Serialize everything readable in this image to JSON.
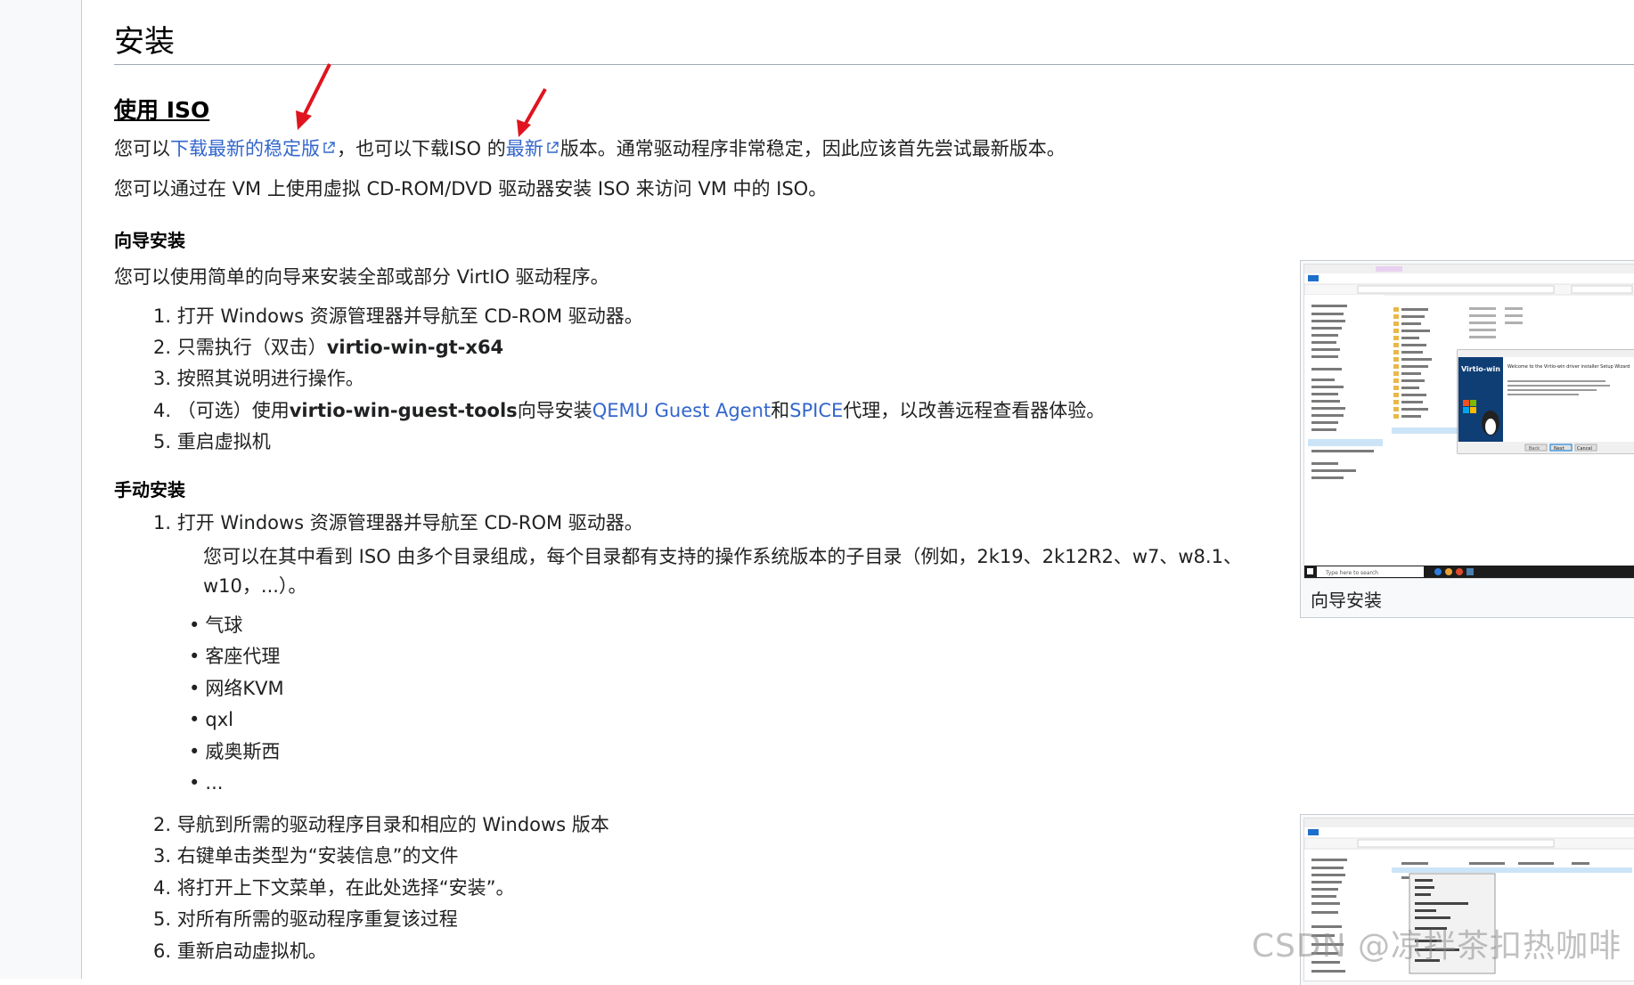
{
  "section_title": "安装",
  "iso": {
    "heading": "使用 ISO",
    "p1": {
      "pre": "您可以",
      "link1": "下载最新的稳定版",
      "mid": "，也可以下载ISO 的",
      "link2": "最新",
      "post": "版本。通常驱动程序非常稳定，因此应该首先尝试最新版本。"
    },
    "p2": "您可以通过在 VM 上使用虚拟 CD-ROM/DVD 驱动器安装 ISO 来访问 VM 中的 ISO。"
  },
  "wizard": {
    "heading": "向导安装",
    "intro": "您可以使用简单的向导来安装全部或部分 VirtIO 驱动程序。",
    "steps": {
      "s1": "1. 打开 Windows 资源管理器并导航至 CD-ROM 驱动器。",
      "s2_pre": "2. 只需执行（双击）",
      "s2_bold": "virtio-win-gt-x64",
      "s3": "3. 按照其说明进行操作。",
      "s4_pre": "4. （可选）使用",
      "s4_bold": "virtio-win-guest-tools",
      "s4_mid": "向导安装",
      "s4_link1": "QEMU Guest Agent",
      "s4_and": "和",
      "s4_link2": "SPICE",
      "s4_post": "代理，以改善远程查看器体验。",
      "s5": "5. 重启虚拟机"
    },
    "thumb_caption": "向导安装"
  },
  "manual": {
    "heading": "手动安装",
    "s1": "1. 打开 Windows 资源管理器并导航至 CD-ROM 驱动器。",
    "s1_desc_line1": "您可以在其中看到 ISO 由多个目录组成，每个目录都有支持的操作系统版本的子目录（例如，2k19、2k12R2、w7、w8.1、",
    "s1_desc_line2": "w10，...）。",
    "bullets": [
      "气球",
      "客座代理",
      "网络KVM",
      "qxl",
      "威奥斯西",
      "..."
    ],
    "s2": "2. 导航到所需的驱动程序目录和相应的 Windows 版本",
    "s3": "3. 右键单击类型为“安装信息”的文件",
    "s4": "4. 将打开上下文菜单，在此处选择“安装”。",
    "s5": "5. 对所有所需的驱动程序重复该过程",
    "s6": "6. 重新启动虚拟机。"
  },
  "screenshot1": {
    "wizard_title": "Virtio-win",
    "welcome": "Welcome to the Virtio-win driver installer Setup Wizard",
    "back": "Back",
    "next": "Next",
    "cancel": "Cancel",
    "search": "Type here to search"
  },
  "watermark": "CSDN @凉拌茶扣热咖啡",
  "colors": {
    "link": "#3366cc",
    "arrow": "#e0141e",
    "text": "#202122"
  }
}
